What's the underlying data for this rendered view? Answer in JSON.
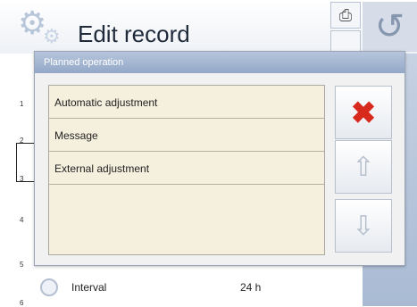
{
  "header": {
    "title": "Edit record"
  },
  "row_numbers": [
    "1",
    "2",
    "3",
    "4",
    "5",
    "6"
  ],
  "interval": {
    "label": "Interval",
    "value": "24 h"
  },
  "dialog": {
    "title": "Planned operation",
    "items": [
      {
        "label": "Automatic adjustment"
      },
      {
        "label": "Message"
      },
      {
        "label": "External adjustment"
      }
    ]
  },
  "icons": {
    "gear": "⚙",
    "print": "⎙",
    "undo": "↺",
    "close": "✖",
    "up": "⇧",
    "down": "⇩"
  },
  "colors": {
    "dialog_title_bg": "#9fb2cf",
    "list_bg": "#f5efdd",
    "close_red": "#d8291d"
  }
}
